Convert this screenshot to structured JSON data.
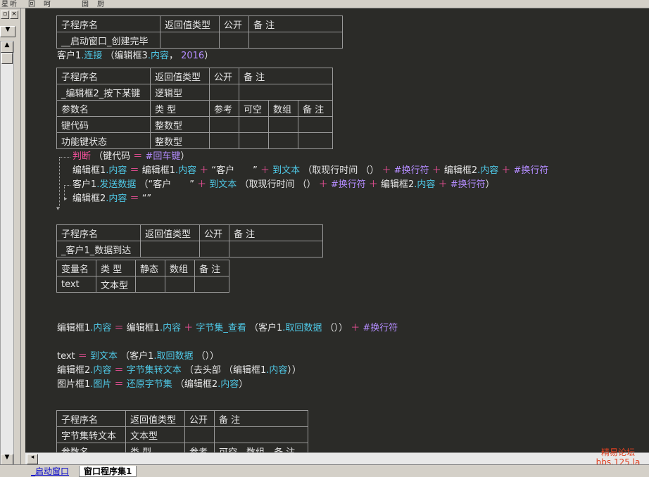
{
  "toolbar": {
    "items": [
      "星",
      "听",
      "回",
      "呵",
      "固",
      "厨"
    ]
  },
  "sub1": {
    "headers": [
      "子程序名",
      "返回值类型",
      "公开",
      "备 注"
    ],
    "name": "__启动窗口_创建完毕"
  },
  "line_connect": {
    "a": "客户1",
    "b": ".连接",
    "c": " （编辑框3",
    "d": ".内容",
    "e": "，",
    "f": " 2016",
    "g": "）"
  },
  "sub2": {
    "headers": [
      "子程序名",
      "返回值类型",
      "公开",
      "备 注"
    ],
    "name": "_编辑框2_按下某键",
    "ret": "逻辑型",
    "param_headers": [
      "参数名",
      "类 型",
      "参考",
      "可空",
      "数组",
      "备 注"
    ],
    "params": [
      {
        "name": "键代码",
        "type": "整数型"
      },
      {
        "name": "功能键状态",
        "type": "整数型"
      }
    ]
  },
  "code2": {
    "l1": {
      "kw": "判断",
      "a": " （键代码 ",
      "op": "＝",
      "b": " #回车键",
      "c": "）"
    },
    "l2": {
      "a": "编辑框1",
      "b": ".内容",
      "op1": " ＝ ",
      "c": "编辑框1",
      "d": ".内容",
      "op2": " ＋ ",
      "s": "“客户　　”",
      "op3": " ＋ ",
      "f": "到文本",
      "g": " （取现行时间 （）",
      "op4": " ＋ ",
      "h": "#换行符",
      "op5": " ＋ ",
      "i": "编辑框2",
      "j": ".内容",
      "op6": " ＋ ",
      "k": "#换行符"
    },
    "l3": {
      "a": "客户1",
      "b": ".发送数据",
      "c": " （“客户　　”",
      "op1": " ＋ ",
      "f": "到文本",
      "g": " （取现行时间 （）",
      "op2": " ＋ ",
      "h": "#换行符",
      "op3": " ＋ ",
      "i": "编辑框2",
      "j": ".内容",
      "op4": " ＋ ",
      "k": "#换行符",
      "l": "）"
    },
    "l4": {
      "a": "编辑框2",
      "b": ".内容",
      "op": " ＝ ",
      "s": "“”"
    }
  },
  "sub3": {
    "headers": [
      "子程序名",
      "返回值类型",
      "公开",
      "备 注"
    ],
    "name": "_客户1_数据到达",
    "var_headers": [
      "变量名",
      "类 型",
      "静态",
      "数组",
      "备 注"
    ],
    "var_name": "text",
    "var_type": "文本型"
  },
  "code3": {
    "l1": {
      "a": "编辑框1",
      "b": ".内容",
      "op1": " ＝ ",
      "c": "编辑框1",
      "d": ".内容",
      "op2": " ＋ ",
      "f": "字节集_查看",
      "g": " （客户1",
      "h": ".取回数据",
      "i": " （）",
      "j": "）",
      "op3": " ＋ ",
      "k": "#换行符"
    },
    "l2": {
      "a": "text",
      "op": " ＝ ",
      "f": "到文本",
      "g": " （客户1",
      "h": ".取回数据",
      "i": " （）",
      "j": "）"
    },
    "l3": {
      "a": "编辑框2",
      "b": ".内容",
      "op": " ＝ ",
      "f": "字节集转文本",
      "g": " （去头部",
      "h": " （编辑框1",
      "i": ".内容",
      "j": "））"
    },
    "l4": {
      "a": "图片框1",
      "b": ".图片",
      "op": " ＝ ",
      "f": "还原字节集",
      "g": " （编辑框2",
      "h": ".内容",
      "i": "）"
    }
  },
  "sub4": {
    "headers": [
      "子程序名",
      "返回值类型",
      "公开",
      "备 注"
    ],
    "name": "字节集转文本",
    "ret": "文本型",
    "param_headers": [
      "参数名",
      "类 型",
      "参考",
      "可空",
      "数组",
      "备 注"
    ]
  },
  "tabs": {
    "tab1": "_启动窗口",
    "tab2": "窗口程序集1"
  },
  "watermark": {
    "line1": "精易论坛",
    "line2": "bbs.125.la"
  }
}
